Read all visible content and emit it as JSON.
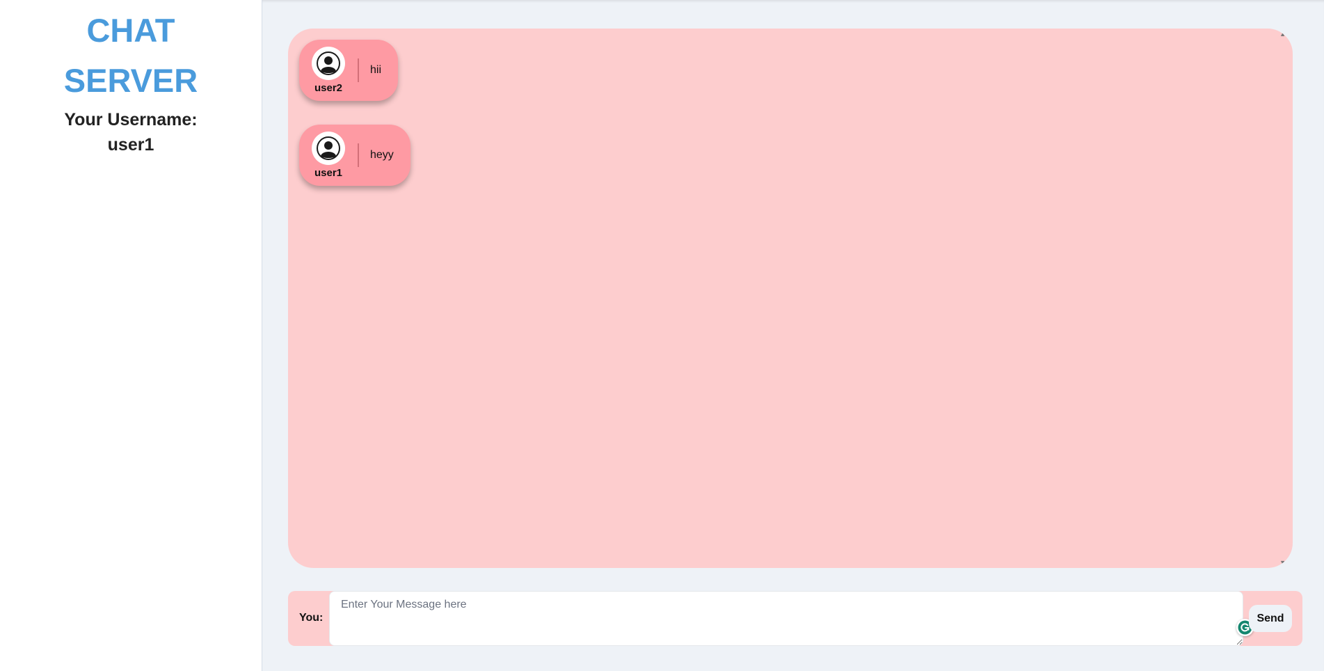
{
  "sidebar": {
    "title_line1": "CHAT",
    "title_line2": "SERVER",
    "username_label": "Your Username:",
    "username": "user1"
  },
  "chat": {
    "messages": [
      {
        "user": "user2",
        "text": "hii"
      },
      {
        "user": "user1",
        "text": "heyy"
      }
    ]
  },
  "composer": {
    "you_label": "You:",
    "input_value": "",
    "input_placeholder": "Enter Your Message here",
    "send_label": "Send"
  },
  "icons": {
    "avatar": "user-circle-icon",
    "grammar": "grammarly-icon",
    "scroll_up": "scroll-up-arrow",
    "scroll_down": "scroll-down-arrow"
  },
  "colors": {
    "brand": "#4a9bdc",
    "chat_bg": "#fdcdce",
    "bubble_bg": "#fe9aa3",
    "page_bg": "#eef2f7",
    "grammar_green": "#15876f"
  }
}
